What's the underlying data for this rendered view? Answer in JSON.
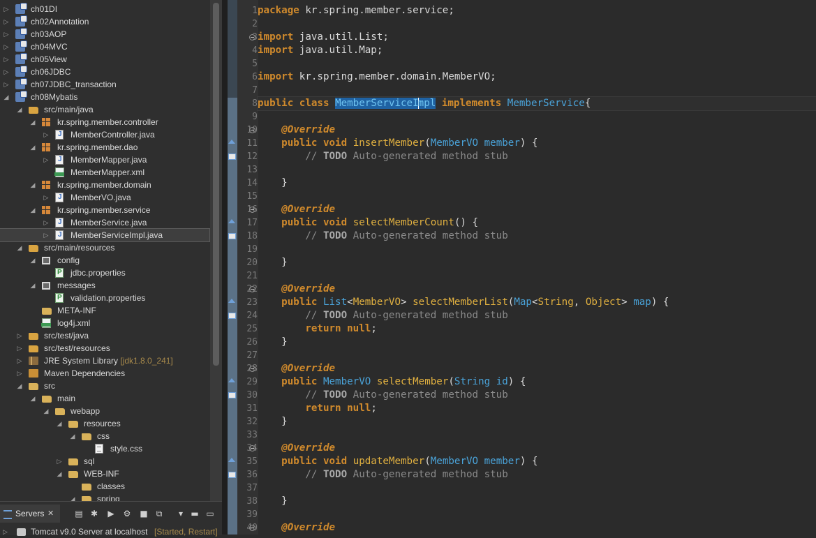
{
  "explorer": {
    "rows": [
      {
        "label": "ch01DI",
        "decoration": "",
        "icon": "project-icon",
        "toggle": "collapsed",
        "indent": 0
      },
      {
        "label": "ch02Annotation",
        "decoration": "",
        "icon": "project-icon",
        "toggle": "collapsed",
        "indent": 0
      },
      {
        "label": "ch03AOP",
        "decoration": "",
        "icon": "project-icon",
        "toggle": "collapsed",
        "indent": 0
      },
      {
        "label": "ch04MVC",
        "decoration": "",
        "icon": "project-icon",
        "toggle": "collapsed",
        "indent": 0
      },
      {
        "label": "ch05View",
        "decoration": "",
        "icon": "project-icon",
        "toggle": "collapsed",
        "indent": 0
      },
      {
        "label": "ch06JDBC",
        "decoration": "",
        "icon": "project-icon",
        "toggle": "collapsed",
        "indent": 0
      },
      {
        "label": "ch07JDBC_transaction",
        "decoration": "",
        "icon": "project-icon",
        "toggle": "collapsed",
        "indent": 0
      },
      {
        "label": "ch08Mybatis",
        "decoration": "",
        "icon": "project-icon",
        "toggle": "expanded",
        "indent": 0
      },
      {
        "label": "src/main/java",
        "decoration": "",
        "icon": "source-folder-icon",
        "toggle": "expanded",
        "indent": 1
      },
      {
        "label": "kr.spring.member.controller",
        "decoration": "",
        "icon": "package-icon",
        "toggle": "expanded",
        "indent": 2
      },
      {
        "label": "MemberController.java",
        "decoration": "",
        "icon": "java-file-icon",
        "toggle": "collapsed",
        "indent": 3
      },
      {
        "label": "kr.spring.member.dao",
        "decoration": "",
        "icon": "package-icon",
        "toggle": "expanded",
        "indent": 2
      },
      {
        "label": "MemberMapper.java",
        "decoration": "",
        "icon": "java-interface-icon",
        "toggle": "collapsed",
        "indent": 3
      },
      {
        "label": "MemberMapper.xml",
        "decoration": "",
        "icon": "xml-mapper-icon",
        "toggle": "none",
        "indent": 3
      },
      {
        "label": "kr.spring.member.domain",
        "decoration": "",
        "icon": "package-icon",
        "toggle": "expanded",
        "indent": 2
      },
      {
        "label": "MemberVO.java",
        "decoration": "",
        "icon": "java-file-icon",
        "toggle": "collapsed",
        "indent": 3
      },
      {
        "label": "kr.spring.member.service",
        "decoration": "",
        "icon": "package-icon",
        "toggle": "expanded",
        "indent": 2
      },
      {
        "label": "MemberService.java",
        "decoration": "",
        "icon": "java-interface-icon",
        "toggle": "collapsed",
        "indent": 3
      },
      {
        "label": "MemberServiceImpl.java",
        "decoration": "",
        "icon": "java-file-icon",
        "toggle": "collapsed",
        "indent": 3,
        "selected": true
      },
      {
        "label": "src/main/resources",
        "decoration": "",
        "icon": "source-folder-icon",
        "toggle": "expanded",
        "indent": 1
      },
      {
        "label": "config",
        "decoration": "",
        "icon": "resource-package-icon",
        "toggle": "expanded",
        "indent": 2
      },
      {
        "label": "jdbc.properties",
        "decoration": "",
        "icon": "properties-file-icon",
        "toggle": "none",
        "indent": 3
      },
      {
        "label": "messages",
        "decoration": "",
        "icon": "resource-package-icon",
        "toggle": "expanded",
        "indent": 2
      },
      {
        "label": "validation.properties",
        "decoration": "",
        "icon": "properties-file-icon",
        "toggle": "none",
        "indent": 3
      },
      {
        "label": "META-INF",
        "decoration": "",
        "icon": "folder-icon",
        "toggle": "none",
        "indent": 2
      },
      {
        "label": "log4j.xml",
        "decoration": "",
        "icon": "xml-file-icon",
        "toggle": "none",
        "indent": 2
      },
      {
        "label": "src/test/java",
        "decoration": "",
        "icon": "source-folder-icon",
        "toggle": "collapsed",
        "indent": 1
      },
      {
        "label": "src/test/resources",
        "decoration": "",
        "icon": "source-folder-icon",
        "toggle": "collapsed",
        "indent": 1
      },
      {
        "label": "JRE System Library",
        "decoration": "[jdk1.8.0_241]",
        "icon": "library-icon",
        "toggle": "collapsed",
        "indent": 1
      },
      {
        "label": "Maven Dependencies",
        "decoration": "",
        "icon": "maven-library-icon",
        "toggle": "collapsed",
        "indent": 1
      },
      {
        "label": "src",
        "decoration": "",
        "icon": "folder-icon",
        "toggle": "expanded",
        "indent": 1
      },
      {
        "label": "main",
        "decoration": "",
        "icon": "folder-icon",
        "toggle": "expanded",
        "indent": 2
      },
      {
        "label": "webapp",
        "decoration": "",
        "icon": "folder-icon",
        "toggle": "expanded",
        "indent": 3
      },
      {
        "label": "resources",
        "decoration": "",
        "icon": "folder-icon",
        "toggle": "expanded",
        "indent": 4
      },
      {
        "label": "css",
        "decoration": "",
        "icon": "folder-icon",
        "toggle": "expanded",
        "indent": 5
      },
      {
        "label": "style.css",
        "decoration": "",
        "icon": "css-file-icon",
        "toggle": "none",
        "indent": 6
      },
      {
        "label": "sql",
        "decoration": "",
        "icon": "folder-icon",
        "toggle": "collapsed",
        "indent": 4
      },
      {
        "label": "WEB-INF",
        "decoration": "",
        "icon": "folder-icon",
        "toggle": "expanded",
        "indent": 4
      },
      {
        "label": "classes",
        "decoration": "",
        "icon": "folder-icon",
        "toggle": "none",
        "indent": 5
      },
      {
        "label": "spring",
        "decoration": "",
        "icon": "folder-icon",
        "toggle": "expanded",
        "indent": 5
      }
    ]
  },
  "servers": {
    "tab_label": "Servers",
    "tab_close": "✕",
    "toolbar_icons": [
      "collapse-icon",
      "debug-server-icon",
      "start-server-icon",
      "profile-server-icon",
      "stop-server-icon",
      "publish-icon",
      "view-menu-icon",
      "minimize-icon",
      "maximize-icon"
    ],
    "server_name": "Tomcat v9.0 Server at localhost",
    "server_status": "[Started, Restart]"
  },
  "editor": {
    "current_line": 7,
    "lines": [
      {
        "n": "1",
        "segments": [
          [
            "kw",
            "package"
          ],
          [
            "",
            " kr.spring.member.service;"
          ]
        ]
      },
      {
        "n": "2",
        "segments": []
      },
      {
        "n": "3",
        "segments": [
          [
            "kw",
            "import"
          ],
          [
            "",
            " java.util.List;"
          ]
        ]
      },
      {
        "n": "4",
        "segments": [
          [
            "kw",
            "import"
          ],
          [
            "",
            " java.util.Map;"
          ]
        ]
      },
      {
        "n": "5",
        "segments": []
      },
      {
        "n": "6",
        "segments": [
          [
            "kw",
            "import"
          ],
          [
            "",
            " kr.spring.member.domain.MemberVO;"
          ]
        ]
      },
      {
        "n": "7",
        "segments": []
      },
      {
        "n": "8",
        "segments": [
          [
            "kw",
            "public"
          ],
          [
            "",
            " "
          ],
          [
            "kw",
            "class"
          ],
          [
            "",
            " "
          ],
          [
            "hl",
            "MemberServiceImpl"
          ],
          [
            "",
            " "
          ],
          [
            "kw",
            "implements"
          ],
          [
            "",
            " "
          ],
          [
            "typ",
            "MemberService"
          ],
          [
            "",
            "{"
          ]
        ]
      },
      {
        "n": "9",
        "segments": []
      },
      {
        "n": "10",
        "segments": [
          [
            "",
            "    "
          ],
          [
            "ann",
            "@Override"
          ]
        ]
      },
      {
        "n": "11",
        "segments": [
          [
            "",
            "    "
          ],
          [
            "kw",
            "public"
          ],
          [
            "",
            " "
          ],
          [
            "kw",
            "void"
          ],
          [
            "",
            " "
          ],
          [
            "mth",
            "insertMember"
          ],
          [
            "",
            "("
          ],
          [
            "typ",
            "MemberVO"
          ],
          [
            "",
            " "
          ],
          [
            "typ",
            "member"
          ],
          [
            "",
            ") {"
          ]
        ]
      },
      {
        "n": "12",
        "segments": [
          [
            "",
            "        "
          ],
          [
            "cmt",
            "// "
          ],
          [
            "todo",
            "TODO"
          ],
          [
            "cmt",
            " Auto-generated method stub"
          ]
        ]
      },
      {
        "n": "13",
        "segments": []
      },
      {
        "n": "14",
        "segments": [
          [
            "",
            "    }"
          ]
        ]
      },
      {
        "n": "15",
        "segments": []
      },
      {
        "n": "16",
        "segments": [
          [
            "",
            "    "
          ],
          [
            "ann",
            "@Override"
          ]
        ]
      },
      {
        "n": "17",
        "segments": [
          [
            "",
            "    "
          ],
          [
            "kw",
            "public"
          ],
          [
            "",
            " "
          ],
          [
            "kw",
            "void"
          ],
          [
            "",
            " "
          ],
          [
            "mth",
            "selectMemberCount"
          ],
          [
            "",
            "() {"
          ]
        ]
      },
      {
        "n": "18",
        "segments": [
          [
            "",
            "        "
          ],
          [
            "cmt",
            "// "
          ],
          [
            "todo",
            "TODO"
          ],
          [
            "cmt",
            " Auto-generated method stub"
          ]
        ]
      },
      {
        "n": "19",
        "segments": []
      },
      {
        "n": "20",
        "segments": [
          [
            "",
            "    }"
          ]
        ]
      },
      {
        "n": "21",
        "segments": []
      },
      {
        "n": "22",
        "segments": [
          [
            "",
            "    "
          ],
          [
            "ann",
            "@Override"
          ]
        ]
      },
      {
        "n": "23",
        "segments": [
          [
            "",
            "    "
          ],
          [
            "kw",
            "public"
          ],
          [
            "",
            " "
          ],
          [
            "typ",
            "List"
          ],
          [
            "",
            "<"
          ],
          [
            "mth",
            "MemberVO"
          ],
          [
            "",
            "> "
          ],
          [
            "mth",
            "selectMemberList"
          ],
          [
            "",
            "("
          ],
          [
            "typ",
            "Map"
          ],
          [
            "",
            "<"
          ],
          [
            "mth",
            "String"
          ],
          [
            "",
            ", "
          ],
          [
            "mth",
            "Object"
          ],
          [
            "",
            "> "
          ],
          [
            "typ",
            "map"
          ],
          [
            "",
            ") {"
          ]
        ]
      },
      {
        "n": "24",
        "segments": [
          [
            "",
            "        "
          ],
          [
            "cmt",
            "// "
          ],
          [
            "todo",
            "TODO"
          ],
          [
            "cmt",
            " Auto-generated method stub"
          ]
        ]
      },
      {
        "n": "25",
        "segments": [
          [
            "",
            "        "
          ],
          [
            "kw",
            "return"
          ],
          [
            "",
            " "
          ],
          [
            "kw",
            "null"
          ],
          [
            "",
            ";"
          ]
        ]
      },
      {
        "n": "26",
        "segments": [
          [
            "",
            "    }"
          ]
        ]
      },
      {
        "n": "27",
        "segments": []
      },
      {
        "n": "28",
        "segments": [
          [
            "",
            "    "
          ],
          [
            "ann",
            "@Override"
          ]
        ]
      },
      {
        "n": "29",
        "segments": [
          [
            "",
            "    "
          ],
          [
            "kw",
            "public"
          ],
          [
            "",
            " "
          ],
          [
            "typ",
            "MemberVO"
          ],
          [
            "",
            " "
          ],
          [
            "mth",
            "selectMember"
          ],
          [
            "",
            "("
          ],
          [
            "typ",
            "String"
          ],
          [
            "",
            " "
          ],
          [
            "typ",
            "id"
          ],
          [
            "",
            ") {"
          ]
        ]
      },
      {
        "n": "30",
        "segments": [
          [
            "",
            "        "
          ],
          [
            "cmt",
            "// "
          ],
          [
            "todo",
            "TODO"
          ],
          [
            "cmt",
            " Auto-generated method stub"
          ]
        ]
      },
      {
        "n": "31",
        "segments": [
          [
            "",
            "        "
          ],
          [
            "kw",
            "return"
          ],
          [
            "",
            " "
          ],
          [
            "kw",
            "null"
          ],
          [
            "",
            ";"
          ]
        ]
      },
      {
        "n": "32",
        "segments": [
          [
            "",
            "    }"
          ]
        ]
      },
      {
        "n": "33",
        "segments": []
      },
      {
        "n": "34",
        "segments": [
          [
            "",
            "    "
          ],
          [
            "ann",
            "@Override"
          ]
        ]
      },
      {
        "n": "35",
        "segments": [
          [
            "",
            "    "
          ],
          [
            "kw",
            "public"
          ],
          [
            "",
            " "
          ],
          [
            "kw",
            "void"
          ],
          [
            "",
            " "
          ],
          [
            "mth",
            "updateMember"
          ],
          [
            "",
            "("
          ],
          [
            "typ",
            "MemberVO"
          ],
          [
            "",
            " "
          ],
          [
            "typ",
            "member"
          ],
          [
            "",
            ") {"
          ]
        ]
      },
      {
        "n": "36",
        "segments": [
          [
            "",
            "        "
          ],
          [
            "cmt",
            "// "
          ],
          [
            "todo",
            "TODO"
          ],
          [
            "cmt",
            " Auto-generated method stub"
          ]
        ]
      },
      {
        "n": "37",
        "segments": []
      },
      {
        "n": "38",
        "segments": [
          [
            "",
            "    }"
          ]
        ]
      },
      {
        "n": "39",
        "segments": []
      },
      {
        "n": "40",
        "segments": [
          [
            "",
            "    "
          ],
          [
            "ann",
            "@Override"
          ]
        ]
      }
    ],
    "fold_lines": [
      3,
      10,
      16,
      22,
      28,
      34,
      40
    ],
    "override_marker_lines": [
      11,
      17,
      23,
      29,
      35
    ],
    "todo_marker_lines": [
      12,
      18,
      24,
      30,
      36
    ]
  }
}
